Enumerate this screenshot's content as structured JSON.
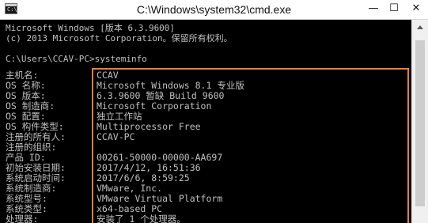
{
  "window": {
    "title": "C:\\Windows\\system32\\cmd.exe",
    "icon_glyph": "C:\\",
    "minimize_glyph": "—",
    "maximize_glyph": "☐",
    "close_glyph": "✕"
  },
  "console": {
    "banner_line1": "Microsoft Windows [版本 6.3.9600]",
    "banner_line2": "(c) 2013 Microsoft Corporation。保留所有权利。",
    "prompt": "C:\\Users\\CCAV-PC>systeminfo",
    "rows": [
      {
        "label": "主机名:",
        "value": "CCAV"
      },
      {
        "label": "OS 名称:",
        "value": "Microsoft Windows 8.1 专业版"
      },
      {
        "label": "OS 版本:",
        "value": "6.3.9600 暂缺 Build 9600"
      },
      {
        "label": "OS 制造商:",
        "value": "Microsoft Corporation"
      },
      {
        "label": "OS 配置:",
        "value": "独立工作站"
      },
      {
        "label": "OS 构件类型:",
        "value": "Multiprocessor Free"
      },
      {
        "label": "注册的所有人:",
        "value": "CCAV-PC"
      },
      {
        "label": "注册的组织:",
        "value": ""
      },
      {
        "label": "产品 ID:",
        "value": "00261-50000-00000-AA697"
      },
      {
        "label": "初始安装日期:",
        "value": "2017/4/12, 16:51:36"
      },
      {
        "label": "系统启动时间:",
        "value": "2017/6/6, 8:59:25"
      },
      {
        "label": "系统制造商:",
        "value": "VMware, Inc."
      },
      {
        "label": "系统型号:",
        "value": "VMware Virtual Platform"
      },
      {
        "label": "系统类型:",
        "value": "x64-based PC"
      },
      {
        "label": "处理器:",
        "value": "安装了 1 个处理器。"
      }
    ]
  },
  "colors": {
    "console_bg": "#000000",
    "console_text": "#c0c0c0",
    "highlight_border": "#e87c3e",
    "titlebar_bg": "#ffffff"
  }
}
